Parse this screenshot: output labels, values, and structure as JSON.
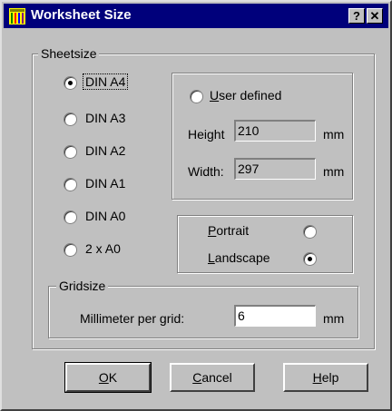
{
  "window": {
    "title": "Worksheet Size",
    "help_glyph": "?",
    "close_glyph": "✕"
  },
  "sheetsize": {
    "label": "Sheetsize",
    "options": [
      {
        "label": "DIN A4",
        "checked": true
      },
      {
        "label": "DIN A3",
        "checked": false
      },
      {
        "label": "DIN A2",
        "checked": false
      },
      {
        "label": "DIN A1",
        "checked": false
      },
      {
        "label": "DIN A0",
        "checked": false
      },
      {
        "label": "2 x A0",
        "checked": false
      }
    ]
  },
  "user_defined": {
    "label_first": "U",
    "label_rest": "ser defined",
    "checked": false,
    "height_label": "Height",
    "height_value": "210",
    "height_unit": "mm",
    "width_label": "Width:",
    "width_value": "297",
    "width_unit": "mm"
  },
  "orientation": {
    "portrait_first": "P",
    "portrait_rest": "ortrait",
    "portrait_checked": false,
    "landscape_first": "L",
    "landscape_rest": "andscape",
    "landscape_checked": true
  },
  "gridsize": {
    "label": "Gridsize",
    "field_label": "Millimeter per grid:",
    "value": "6",
    "unit": "mm"
  },
  "buttons": {
    "ok_first": "O",
    "ok_rest": "K",
    "cancel_first": "C",
    "cancel_rest": "ancel",
    "help_first": "H",
    "help_rest": "elp"
  },
  "colors": {
    "titlebar": "#00007b",
    "face": "#c0c0c0"
  }
}
